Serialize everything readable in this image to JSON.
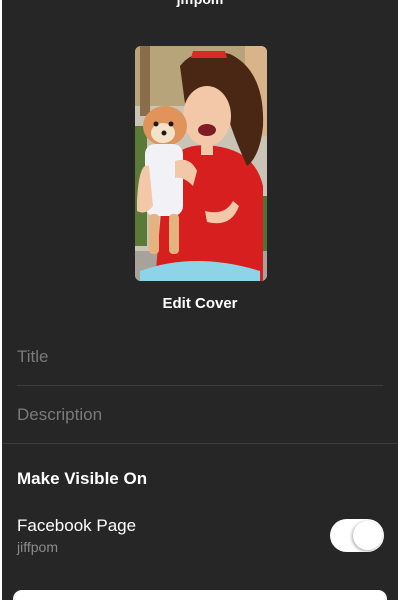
{
  "header": {
    "account_name": "jiffpom"
  },
  "cover": {
    "image_alt": "Cover photo of a woman holding a small dog",
    "edit_label": "Edit Cover"
  },
  "form": {
    "title_placeholder": "Title",
    "description_placeholder": "Description"
  },
  "visibility": {
    "heading": "Make Visible On",
    "facebook_page": {
      "label": "Facebook Page",
      "sublabel": "jiffpom",
      "enabled": true
    }
  },
  "colors": {
    "background": "#262626",
    "text": "#ffffff",
    "placeholder": "#7a7a7a",
    "divider": "#3c3c3c",
    "toggle_on": "#ffffff"
  }
}
